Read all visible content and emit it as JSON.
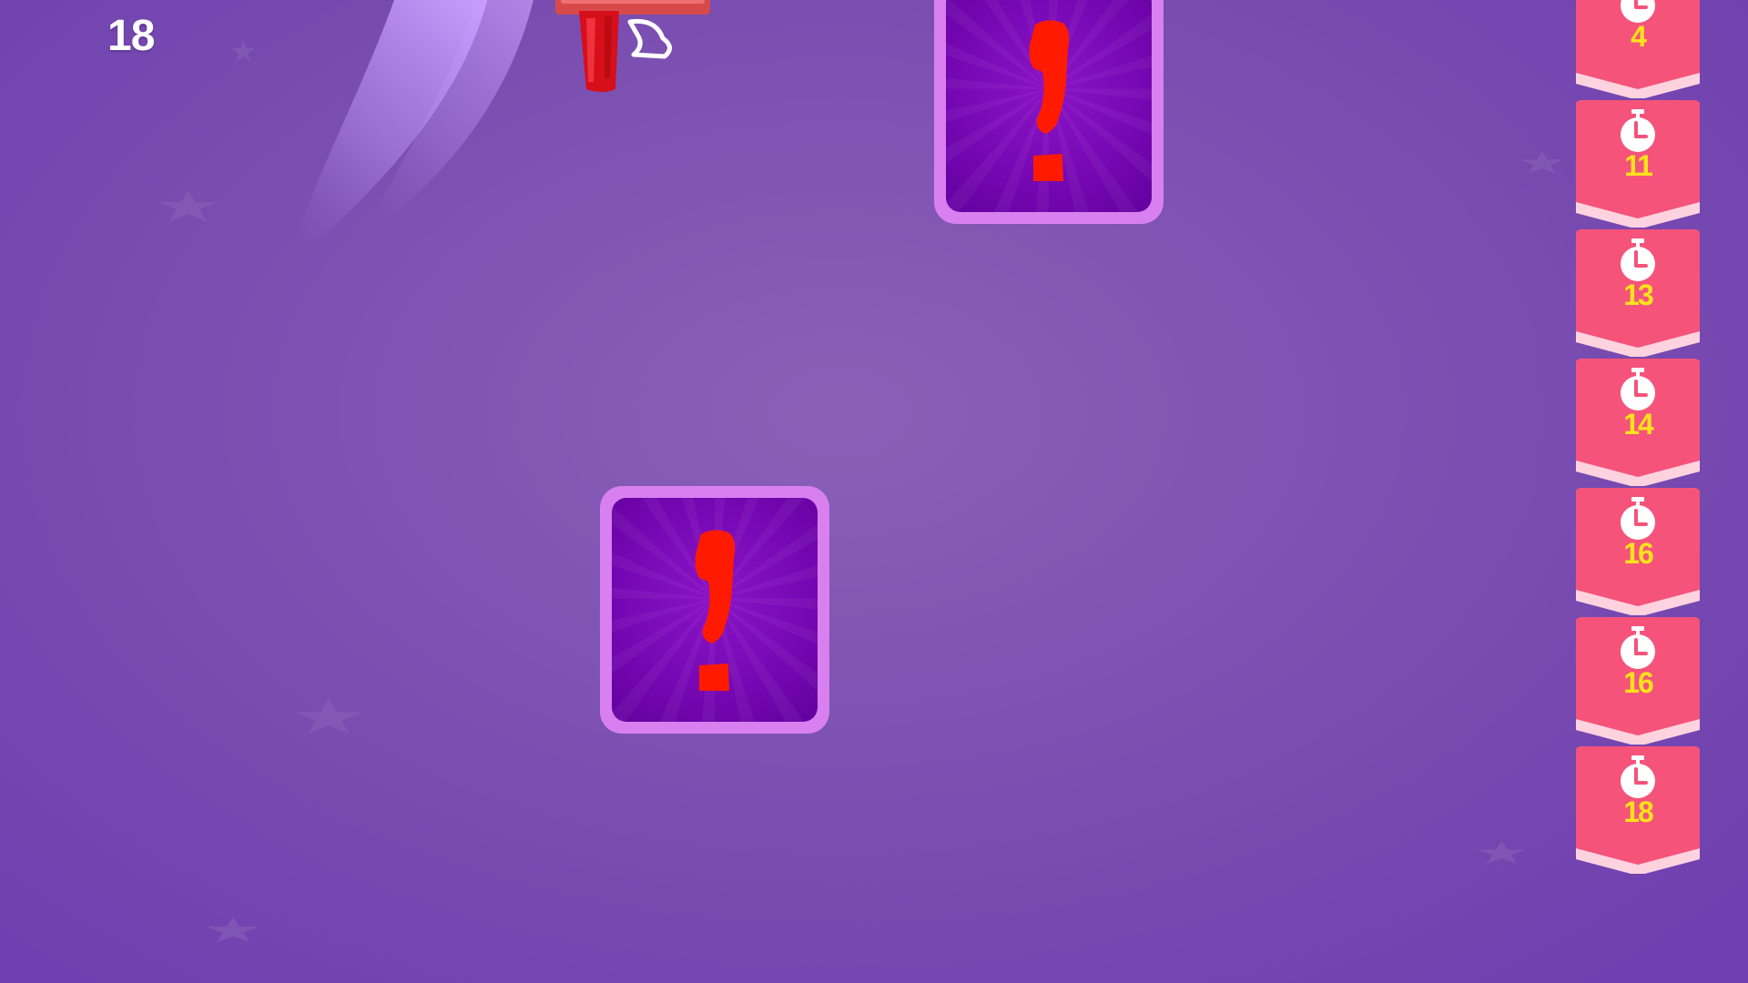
{
  "hud": {
    "score": "18"
  },
  "tiles": {
    "top": {
      "icon": "question-mark-icon",
      "color": "#ff1a00"
    },
    "bottom": {
      "icon": "question-mark-icon",
      "color": "#ff1a00"
    }
  },
  "levels": [
    {
      "icon": "stopwatch-icon",
      "value": "4"
    },
    {
      "icon": "stopwatch-icon",
      "value": "11"
    },
    {
      "icon": "stopwatch-icon",
      "value": "13"
    },
    {
      "icon": "stopwatch-icon",
      "value": "14"
    },
    {
      "icon": "stopwatch-icon",
      "value": "16"
    },
    {
      "icon": "stopwatch-icon",
      "value": "16"
    },
    {
      "icon": "stopwatch-icon",
      "value": "18"
    }
  ],
  "colors": {
    "background": "#7f54b2",
    "tile_border": "#d880f0",
    "tile_fill": "#7708b4",
    "question_mark": "#ff1a00",
    "ribbon": "#f5537a",
    "ribbon_number": "#ffe21c",
    "score_text": "#ffffff"
  }
}
